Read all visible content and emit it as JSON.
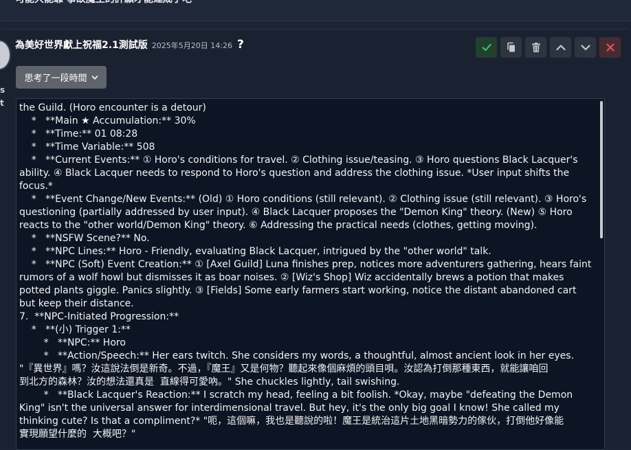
{
  "top_message": {
    "text": "可能只能靠 事故魔王的評願才能達成了吧"
  },
  "message": {
    "character_name": "為美好世界獻上祝福2.1測試版",
    "timestamp": "2025年5月20日 14:26",
    "help_symbol": "?",
    "side_letters": [
      "s",
      "t"
    ],
    "actions": [
      {
        "name": "confirm-button",
        "icon": "checkmark-icon",
        "color": "#3dbb63"
      },
      {
        "name": "copy-button",
        "icon": "copy-icon",
        "color": "#c5c9d1"
      },
      {
        "name": "delete-button",
        "icon": "trash-icon",
        "color": "#c5c9d1"
      },
      {
        "name": "move-up-button",
        "icon": "chevron-up-icon",
        "color": "#c5c9d1"
      },
      {
        "name": "move-down-button",
        "icon": "chevron-down-icon",
        "color": "#c5c9d1"
      },
      {
        "name": "cancel-button",
        "icon": "close-icon",
        "color": "#e0535e"
      }
    ],
    "thinking_toggle": {
      "label": "思考了一段時間"
    },
    "lines": [
      "the Guild. (Horo encounter is a detour)",
      "    *   **Main ★ Accumulation:** 30%",
      "    *   **Time:** 01 08:28",
      "    *   **Time Variable:** 508",
      "    *   **Current Events:** ① Horo's conditions for travel. ② Clothing issue/teasing. ③ Horo questions Black Lacquer's",
      "ability. ④ Black Lacquer needs to respond to Horo's question and address the clothing issue. *User input shifts the",
      "focus.*",
      "    *   **Event Change/New Events:** (Old) ① Horo conditions (still relevant). ② Clothing issue (still relevant). ③ Horo's",
      "questioning (partially addressed by user input). ④ Black Lacquer proposes the \"Demon King\" theory. (New) ⑤ Horo",
      "reacts to the \"other world/Demon King\" theory. ⑥ Addressing the practical needs (clothes, getting moving).",
      "    *   **NSFW Scene?** No.",
      "    *   **NPC Lines:** Horo - Friendly, evaluating Black Lacquer, intrigued by the \"other world\" talk.",
      "    *   **NPC (Soft) Event Creation:** ① [Axel Guild] Luna finishes prep, notices more adventurers gathering, hears faint",
      "rumors of a wolf howl but dismisses it as boar noises. ② [Wiz's Shop] Wiz accidentally brews a potion that makes",
      "potted plants giggle. Panics slightly. ③ [Fields] Some early farmers start working, notice the distant abandoned cart",
      "but keep their distance.",
      "7.  **NPC-Initiated Progression:**",
      "    *   **(小) Trigger 1:**",
      "        *   **NPC:** Horo",
      "        *   **Action/Speech:** Her ears twitch. She considers my words, a thoughtful, almost ancient look in her eyes.",
      "\"『異世界』嗎？汝這說法倒是新奇。不過，『魔王』又是何物？聽起來像個麻煩的頭目唄。汝認為打倒那種東西，就能讓咱回",
      "到北方的森林？汝的想法還真是  直線得可愛吶。\" She chuckles lightly, tail swishing.",
      "        *   **Black Lacquer's Reaction:** I scratch my head, feeling a bit foolish. *Okay, maybe \"defeating the Demon",
      "King\" isn't the universal answer for interdimensional travel. But hey, it's the only big goal I know! She called my",
      "thinking cute? Is that a compliment?* \"呃，這個嘛，我也是聽說的啦！魔王是統治這片土地黑暗勢力的傢伙，打倒他好像能",
      "實現願望什麼的  大概吧？\""
    ]
  }
}
